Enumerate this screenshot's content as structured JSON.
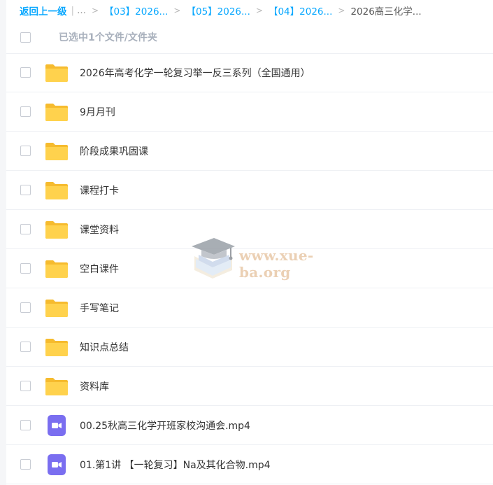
{
  "breadcrumb": {
    "back_label": "返回上一级",
    "pipe": "|",
    "ellipsis": "...",
    "items": [
      "【03】2026...",
      "【05】2026...",
      "【04】2026..."
    ],
    "separator": ">",
    "current": "2026高三化学..."
  },
  "header": {
    "selected_text": "已选中1个文件/文件夹"
  },
  "files": [
    {
      "name": "2026年高考化学一轮复习举一反三系列（全国通用）",
      "icon": "folder-icon"
    },
    {
      "name": "9月月刊",
      "icon": "folder-icon"
    },
    {
      "name": "阶段成果巩固课",
      "icon": "folder-icon"
    },
    {
      "name": "课程打卡",
      "icon": "folder-icon"
    },
    {
      "name": "课堂资料",
      "icon": "folder-icon"
    },
    {
      "name": "空白课件",
      "icon": "folder-icon"
    },
    {
      "name": "手写笔记",
      "icon": "folder-icon"
    },
    {
      "name": "知识点总结",
      "icon": "folder-icon"
    },
    {
      "name": "资料库",
      "icon": "folder-icon"
    },
    {
      "name": "00.25秋高三化学开班家校沟通会.mp4",
      "icon": "video-icon"
    },
    {
      "name": "01.第1讲 【一轮复习】Na及其化合物.mp4",
      "icon": "video-icon"
    }
  ],
  "watermark": {
    "text": "www.xue-ba.org",
    "icon": "graduation-cap-icon"
  },
  "colors": {
    "link": "#06a7ff",
    "folder": "#ffd24d",
    "video": "#7a6ef0"
  }
}
